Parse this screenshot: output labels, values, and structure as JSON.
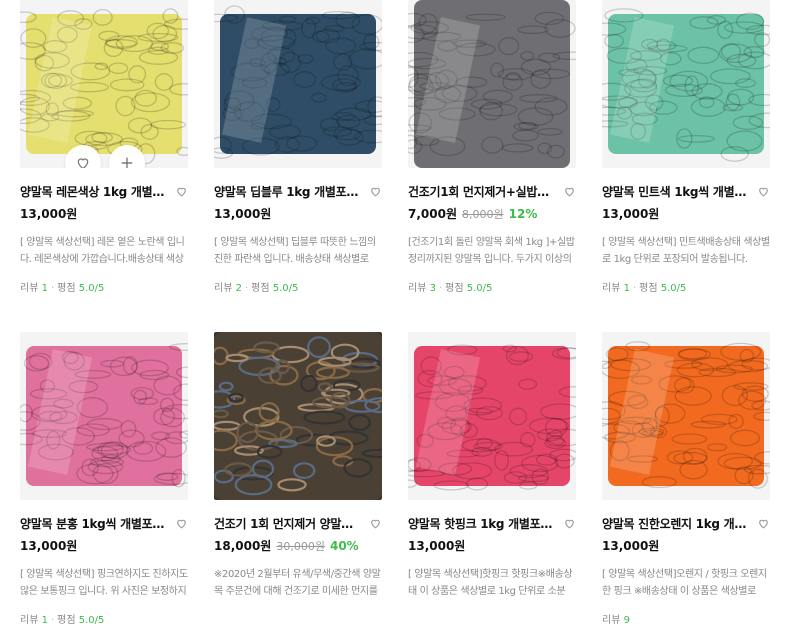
{
  "colors": {
    "accent_green": "#3dbb4b",
    "text_dark": "#111111",
    "text_muted": "#888888"
  },
  "overlay": {
    "wishlist_icon": "heart-outline-icon",
    "add_icon": "plus-icon"
  },
  "meta_labels": {
    "review": "리뷰",
    "rating": "평점"
  },
  "products": [
    {
      "title": "양말목 레몬색상 1kg 개별포장 옅은...",
      "price": "13,000원",
      "original_price": "",
      "discount": "",
      "desc": "[ 양말목 색상선택] 레몬 옅은 노란색 입니다. 레몬색상에 가깝습니다.배송상태 색상별로 1",
      "reviews": "1",
      "rating": "5.0/5",
      "thumb_color": "#e4df6e"
    },
    {
      "title": "양말목 딥블루 1kg 개별포장 네이비...",
      "price": "13,000원",
      "original_price": "",
      "discount": "",
      "desc": "[ 양말목 색상선택] 딥블루 따뜻한 느낌의 진한 파란색 입니다. 배송상태 색상별로 1kg 단",
      "reviews": "2",
      "rating": "5.0/5",
      "thumb_color": "#2f4d66"
    },
    {
      "title": "건조기1회 먼지제거+실밥정리 양말...",
      "price": "7,000원",
      "original_price": "8,000원",
      "discount": "12%",
      "desc": "[건조기1회 돌린 양말목 회색 1kg ]+실밥정리까지된 양말목 입니다. 두가지 이상의 색상을",
      "reviews": "3",
      "rating": "5.0/5",
      "thumb_color": "#6f6f73"
    },
    {
      "title": "양말목 민트색 1kg씩 개별포장 파스...",
      "price": "13,000원",
      "original_price": "",
      "discount": "",
      "desc": "[ 양말목 색상선택] 민트색배송상태 색상별로 1kg 단위로 포장되어 발송됩니다. (0.9g~",
      "reviews": "1",
      "rating": "5.0/5",
      "thumb_color": "#6cc2a6"
    },
    {
      "title": "양말목 분홍 1kg씩 개별포장 핑크...",
      "price": "13,000원",
      "original_price": "",
      "discount": "",
      "desc": "[ 양말목 색상선택] 핑크연하지도 진하지도 않은 보통핑크 입니다. 위 사진은 보정하지 않",
      "reviews": "1",
      "rating": "5.0/5",
      "thumb_color": "#e0709e"
    },
    {
      "title": "건조기 1회 먼지제거 양말목 무색...",
      "price": "18,000원",
      "original_price": "30,000원",
      "discount": "40%",
      "desc": "※2020년 2월부터 유색/무색/중간색 양말목 주문건에 대해 건조기로 미세한 먼지를 1회",
      "reviews": "",
      "rating": "",
      "thumb_color": "#4a4034"
    },
    {
      "title": "양말목 핫핑크 1kg 개별포장 분홍...",
      "price": "13,000원",
      "original_price": "",
      "discount": "",
      "desc": "[ 양말목 색상선택]핫핑크 핫핑크※배송상태 이 상품은 색상별로 1kg 단위로 소분 포장되",
      "reviews": "",
      "rating": "",
      "thumb_color": "#e6456a"
    },
    {
      "title": "양말목 진한오렌지 1kg 개별포장...",
      "price": "13,000원",
      "original_price": "",
      "discount": "",
      "desc": "[ 양말목 색상선택]오렌지 / 핫핑크 오렌지한 핑크 ※배송상태 이 상품은 색상별로 1kg 단",
      "reviews": "9",
      "rating": "",
      "thumb_color": "#f26a1f"
    }
  ]
}
